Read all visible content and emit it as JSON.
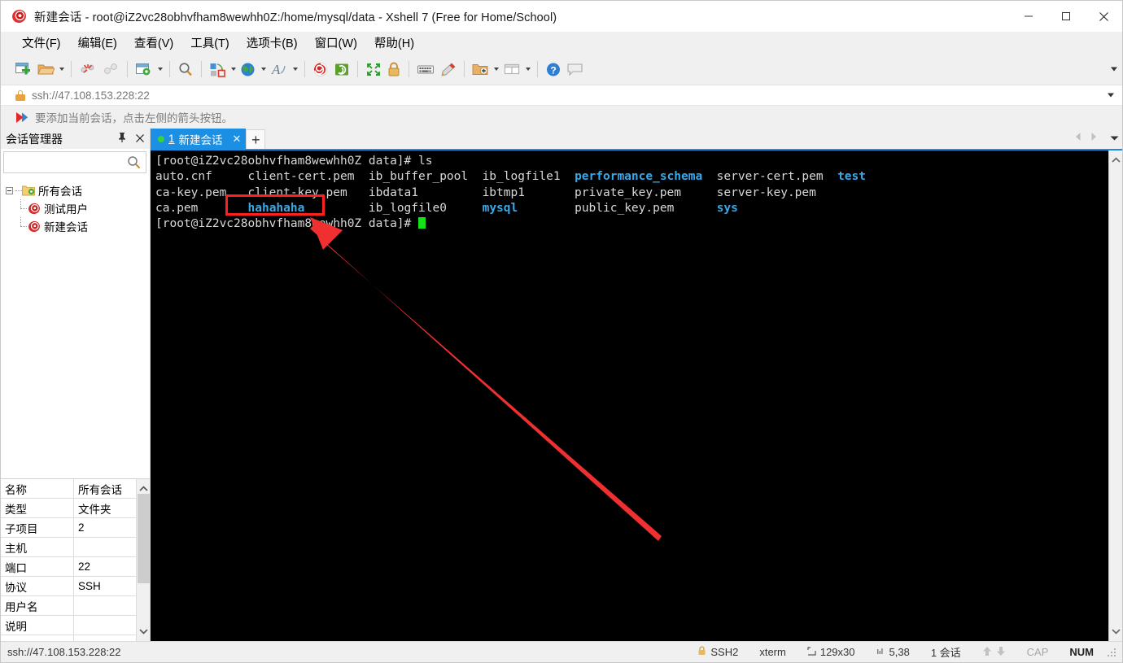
{
  "window": {
    "title": "新建会话 - root@iZ2vc28obhvfham8wewhh0Z:/home/mysql/data - Xshell 7 (Free for Home/School)",
    "minimize_label": "—",
    "maximize_label": "□",
    "close_label": "✕",
    "app_icon": "xshell-logo-icon"
  },
  "menubar": {
    "items": [
      {
        "text": "文件(F)",
        "accel": "F"
      },
      {
        "text": "编辑(E)",
        "accel": "E"
      },
      {
        "text": "查看(V)",
        "accel": "V"
      },
      {
        "text": "工具(T)",
        "accel": "T"
      },
      {
        "text": "选项卡(B)",
        "accel": "B"
      },
      {
        "text": "窗口(W)",
        "accel": "W"
      },
      {
        "text": "帮助(H)",
        "accel": "H"
      }
    ]
  },
  "toolbar": {
    "buttons": [
      {
        "name": "new-session-icon",
        "dropdown": false
      },
      {
        "name": "open-folder-icon",
        "dropdown": true
      },
      {
        "name": "disconnect-icon",
        "dropdown": false
      },
      {
        "name": "reconnect-icon",
        "dropdown": false
      },
      {
        "name": "session-properties-icon",
        "dropdown": true
      },
      {
        "name": "find-icon",
        "dropdown": false
      },
      {
        "name": "transfer-file-icon",
        "dropdown": true
      },
      {
        "name": "globe-icon",
        "dropdown": true
      },
      {
        "name": "font-icon",
        "dropdown": true
      },
      {
        "name": "xshell-spiral-icon",
        "dropdown": false
      },
      {
        "name": "xftp-icon",
        "dropdown": false
      },
      {
        "name": "fullscreen-icon",
        "dropdown": false
      },
      {
        "name": "lock-icon",
        "dropdown": false
      },
      {
        "name": "keyboard-icon",
        "dropdown": false
      },
      {
        "name": "highlight-pen-icon",
        "dropdown": false
      },
      {
        "name": "add-folder-icon",
        "dropdown": true
      },
      {
        "name": "layout-icon",
        "dropdown": true
      },
      {
        "name": "help-icon",
        "dropdown": false
      },
      {
        "name": "chat-icon",
        "dropdown": false
      }
    ],
    "overflow_label": "▾"
  },
  "address_bar": {
    "url": "ssh://47.108.153.228:22",
    "lock_icon": "lock-icon",
    "dropdown_icon": "chevron-down-icon"
  },
  "notice_bar": {
    "text": "要添加当前会话，点击左侧的箭头按钮。",
    "icon": "arrow-flag-icon"
  },
  "sidebar": {
    "title": "会话管理器",
    "pin_icon": "pin-icon",
    "close_icon": "close-icon",
    "search": {
      "value": "",
      "placeholder": "",
      "icon": "search-icon"
    },
    "tree": {
      "root": {
        "label": "所有会话",
        "icon": "folder-sessions-icon",
        "expanded": true
      },
      "children": [
        {
          "label": "测试用户",
          "icon": "session-icon"
        },
        {
          "label": "新建会话",
          "icon": "session-icon"
        }
      ]
    }
  },
  "properties": {
    "rows": [
      {
        "key": "名称",
        "value": "所有会话"
      },
      {
        "key": "类型",
        "value": "文件夹"
      },
      {
        "key": "子项目",
        "value": "2"
      },
      {
        "key": "主机",
        "value": ""
      },
      {
        "key": "端口",
        "value": "22"
      },
      {
        "key": "协议",
        "value": "SSH"
      },
      {
        "key": "用户名",
        "value": ""
      },
      {
        "key": "说明",
        "value": ""
      }
    ],
    "scroll_up_icon": "chevron-up-icon",
    "scroll_down_icon": "chevron-down-icon"
  },
  "tabs": {
    "items": [
      {
        "number": "1",
        "label": "新建会话",
        "active": true,
        "status_dot": "#3ad23a",
        "close_icon": "close-icon"
      }
    ],
    "add_label": "+",
    "nav_prev_icon": "chevron-left-icon",
    "nav_next_icon": "chevron-right-icon",
    "nav_list_icon": "chevron-down-icon"
  },
  "terminal": {
    "prompt": "[root@iZ2vc28obhvfham8wewhh0Z data]#",
    "command": "ls",
    "lines": [
      {
        "segments": [
          {
            "text": "[root@iZ2vc28obhvfham8wewhh0Z data]# ls",
            "style": "normal"
          }
        ]
      },
      {
        "segments": [
          {
            "text": "auto.cnf     client-cert.pem  ib_buffer_pool  ib_logfile1  ",
            "style": "normal"
          },
          {
            "text": "performance_schema",
            "style": "dir"
          },
          {
            "text": "  server-cert.pem  ",
            "style": "normal"
          },
          {
            "text": "test",
            "style": "dir"
          }
        ]
      },
      {
        "segments": [
          {
            "text": "ca-key.pem   client-key.pem   ibdata1         ibtmp1       private_key.pem     server-key.pem",
            "style": "normal"
          }
        ]
      },
      {
        "segments": [
          {
            "text": "ca.pem       ",
            "style": "normal"
          },
          {
            "text": "hahahaha",
            "style": "dir"
          },
          {
            "text": "         ib_logfile0     ",
            "style": "normal"
          },
          {
            "text": "mysql",
            "style": "dir"
          },
          {
            "text": "        public_key.pem      ",
            "style": "normal"
          },
          {
            "text": "sys",
            "style": "dir"
          }
        ]
      },
      {
        "segments": [
          {
            "text": "[root@iZ2vc28obhvfham8wewhh0Z data]# ",
            "style": "normal"
          },
          {
            "text": "",
            "style": "cursor"
          }
        ]
      }
    ],
    "files": [
      "auto.cnf",
      "ca-key.pem",
      "ca.pem",
      "client-cert.pem",
      "client-key.pem",
      "hahahaha",
      "ib_buffer_pool",
      "ibdata1",
      "ib_logfile0",
      "ib_logfile1",
      "ibtmp1",
      "mysql",
      "performance_schema",
      "private_key.pem",
      "public_key.pem",
      "server-cert.pem",
      "server-key.pem",
      "sys",
      "test"
    ],
    "directories": [
      "hahahaha",
      "mysql",
      "performance_schema",
      "sys",
      "test"
    ],
    "colors": {
      "background": "#000000",
      "text": "#d8d8d8",
      "directory": "#3aa8e8",
      "cursor": "#16e016"
    },
    "scroll_up_icon": "chevron-up-icon",
    "scroll_down_icon": "chevron-down-icon"
  },
  "annotation": {
    "highlight_target": "hahahaha",
    "box_color": "#ff2020",
    "arrow_color": "#f03030"
  },
  "statusbar": {
    "connection": "ssh://47.108.153.228:22",
    "protocol": "SSH2",
    "terminal_type": "xterm",
    "size": "129x30",
    "cursor_position": "5,38",
    "session_count": "1 会话",
    "cap_label": "CAP",
    "num_label": "NUM",
    "lock_icon": "lock-icon",
    "size_icon": "resize-icon",
    "cursor_icon": "cursor-icon",
    "up_icon": "arrow-up-icon",
    "down_icon": "arrow-down-icon"
  }
}
